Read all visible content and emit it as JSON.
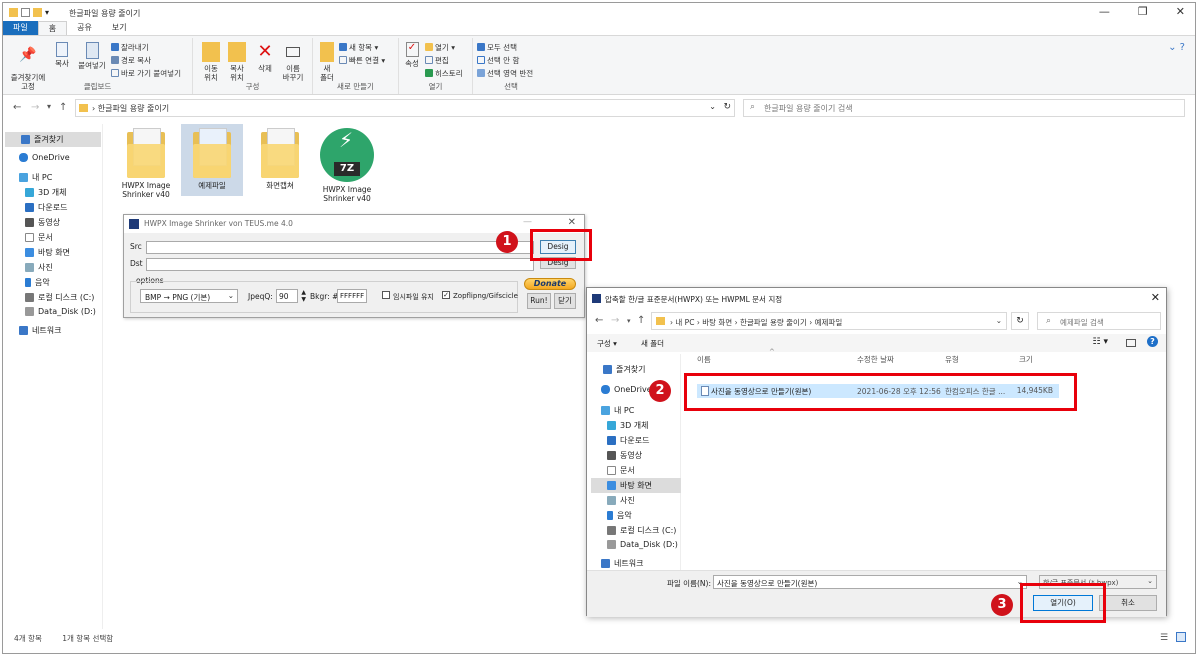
{
  "window": {
    "title": "한글파일 용량 줄이기",
    "minimize": "—",
    "maximize": "❐",
    "close": "✕"
  },
  "ribbon": {
    "tabs": [
      "파일",
      "홈",
      "공유",
      "보기"
    ],
    "clipboard": {
      "pin": "즐겨찾기에\n고정",
      "copy": "복사",
      "paste": "붙여넣기",
      "cut": "잘라내기",
      "copy_path": "경로 복사",
      "paste_shortcut": "바로 가기 붙여넣기",
      "label": "클립보드"
    },
    "organize": {
      "move": "이동\n위치",
      "copyto": "복사\n위치",
      "delete": "삭제",
      "rename": "이름\n바꾸기",
      "label": "구성"
    },
    "new": {
      "folder": "새\n폴더",
      "new_item": "새 항목",
      "easy_access": "빠른 연결",
      "label": "새로 만들기"
    },
    "open": {
      "properties": "속성",
      "open": "열기",
      "edit": "편집",
      "history": "히스토리",
      "label": "열기"
    },
    "select": {
      "all": "모두 선택",
      "none": "선택 안 함",
      "invert": "선택 영역 반전",
      "label": "선택"
    }
  },
  "address": {
    "path": "한글파일 용량 줄이기",
    "search_placeholder": "한글파일 용량 줄이기 검색"
  },
  "nav": {
    "quick": "즐겨찾기",
    "onedrive": "OneDrive",
    "pc": "내 PC",
    "obj3d": "3D 개체",
    "downloads": "다운로드",
    "videos": "동영상",
    "docs": "문서",
    "desktop": "바탕 화면",
    "pictures": "사진",
    "music": "음악",
    "localdisk": "로컬 디스크 (C:)",
    "datadisk": "Data_Disk (D:)",
    "network": "네트워크"
  },
  "files": [
    {
      "name": "HWPX Image\nShrinker v40"
    },
    {
      "name": "예제파일"
    },
    {
      "name": "화면캡쳐"
    },
    {
      "name": "HWPX Image\nShrinker v40"
    }
  ],
  "status": {
    "count": "4개 항목",
    "selected": "1개 항목 선택함"
  },
  "app": {
    "title": "HWPX Image Shrinker von TEUS.me 4.0",
    "src_label": "Src",
    "dst_label": "Dst",
    "desig_btn": "Desig",
    "desig_btn2": "Desig",
    "options_label": "options",
    "format": "BMP → PNG (기본)",
    "jpeg_label": "JpeqQ:",
    "jpeg_value": "90",
    "bkgr_label": "Bkgr: #",
    "bkgr_value": "FFFFFF",
    "keep_temp": "임시파일 유지",
    "zopfli": "Zopflipng/Gifscicle",
    "donate": "Donate",
    "run": "Run!",
    "close": "닫기"
  },
  "dialog": {
    "title": "압축할 한/글 표준문서(HWPX) 또는 HWPML 문서 지정",
    "path": [
      "내 PC",
      "바탕 화면",
      "한글파일 용량 줄이기",
      "예제파일"
    ],
    "search_placeholder": "예제파일 검색",
    "organize": "구성 ▾",
    "new_folder": "새 폴더",
    "columns": {
      "name": "이름",
      "date": "수정한 날짜",
      "type": "유형",
      "size": "크기"
    },
    "file": {
      "name": "사진을 동영상으로 만들기(원본)",
      "date": "2021-06-28 오후 12:56",
      "type": "한컴오피스 한글 ...",
      "size": "14,945KB"
    },
    "filename_label": "파일 이름(N):",
    "filename_value": "사진을 동영상으로 만들기(원본)",
    "filetype_value": "한/글 표준문서 (*.hwpx)",
    "open_btn": "열기(O)",
    "cancel_btn": "취소"
  },
  "badges": [
    "1",
    "2",
    "3"
  ]
}
